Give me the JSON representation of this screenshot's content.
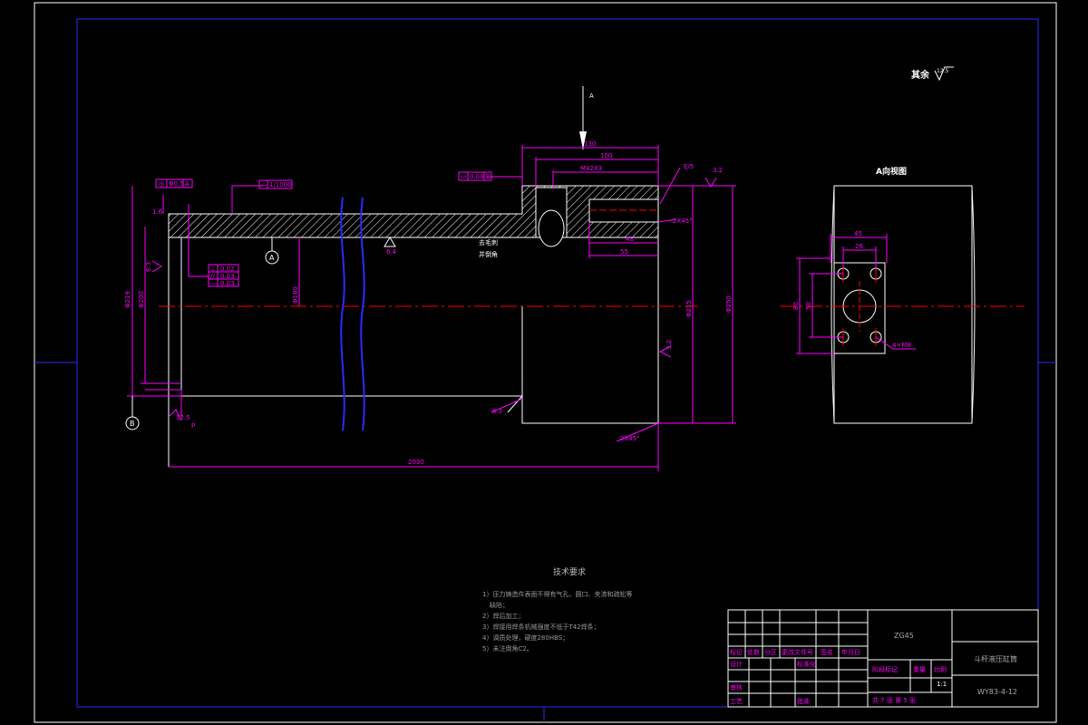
{
  "roughness": {
    "label": "其余",
    "value": "12.5"
  },
  "view_arrow": {
    "label": "A"
  },
  "section_view": {
    "title": "A向视图"
  },
  "tolerances": {
    "concentricity": [
      "◎",
      "Φ0.5",
      "A"
    ],
    "flatness": [
      "▭",
      "0.04",
      "B"
    ],
    "straightness": [
      "—",
      "1/1000"
    ],
    "group": [
      [
        "⊥",
        "0.02"
      ],
      [
        "/∕",
        "0.03"
      ],
      [
        "—",
        "0.03"
      ]
    ]
  },
  "dimensions": {
    "total_length": "2030",
    "d130": "130",
    "d100": "100",
    "thread": "M42X3",
    "d48": "48",
    "d55": "55",
    "chamfer1": "2X45°",
    "chamfer2": "2X45°",
    "d219": "Φ219",
    "d200": "Φ200",
    "d180": "Φ180",
    "d215": "Φ215",
    "d250": "Φ250",
    "view_45": "45",
    "view_26": "26",
    "view_80": "80",
    "view_50": "50",
    "holes": "4×M8",
    "r1": "3.2",
    "r2": "6.3",
    "r3": "3.2",
    "r4": "1.6",
    "r5": "6.3",
    "r6": "6.4",
    "r7": "12.5",
    "datum_a": "A",
    "datum_b": "B",
    "weld_p": "P",
    "e_label": "E/5",
    "weld_note_1": "去毛刺",
    "weld_note_2": "并倒角"
  },
  "notes": {
    "title": "技术要求",
    "lines": [
      "1）压力铸造件表面不得有气孔、圆口、夹渣和疏松等",
      "缺陷；",
      "2）焊后加工；",
      "3）焊接用焊条机械强度不低于T42焊条；",
      "4）调质处理，硬度280HBS；",
      "5）未注倒角C2。"
    ]
  },
  "title_block": {
    "material": "ZG45",
    "part_name": "斗杆液压缸筒",
    "drawing_no": "WY83-4-12",
    "scale": "1:1",
    "headers": [
      "标记",
      "处数",
      "分区",
      "更改文件号",
      "签名",
      "年月日"
    ],
    "roles": [
      "设计",
      "标准化",
      "审核",
      "工艺",
      "批准"
    ],
    "stage_label": "阶段标记",
    "weight_label": "重量",
    "scale_label": "比例",
    "sheets": "共 7 张  第 5 张"
  }
}
